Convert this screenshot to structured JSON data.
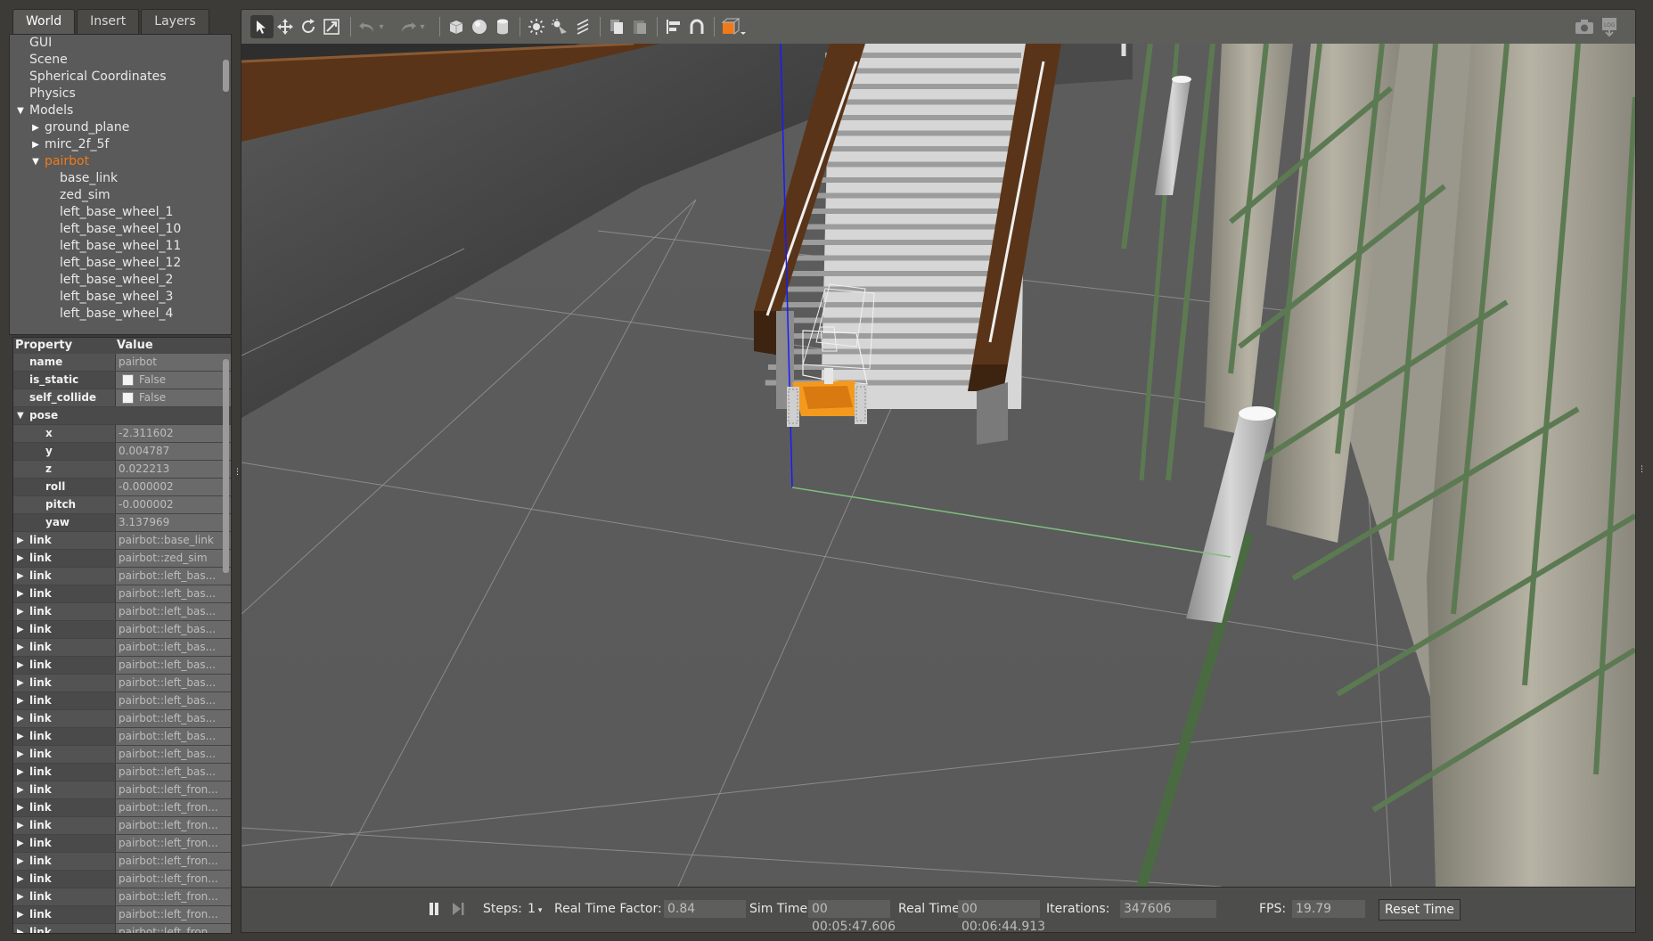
{
  "tabs": [
    "World",
    "Insert",
    "Layers"
  ],
  "tree": [
    {
      "label": "GUI",
      "indent": 0,
      "arrow": ""
    },
    {
      "label": "Scene",
      "indent": 0,
      "arrow": ""
    },
    {
      "label": "Spherical Coordinates",
      "indent": 0,
      "arrow": ""
    },
    {
      "label": "Physics",
      "indent": 0,
      "arrow": ""
    },
    {
      "label": "Models",
      "indent": 0,
      "arrow": "down"
    },
    {
      "label": "ground_plane",
      "indent": 1,
      "arrow": "right"
    },
    {
      "label": "mirc_2f_5f",
      "indent": 1,
      "arrow": "right"
    },
    {
      "label": "pairbot",
      "indent": 1,
      "arrow": "down",
      "selected": true
    },
    {
      "label": "base_link",
      "indent": 2,
      "arrow": ""
    },
    {
      "label": "zed_sim",
      "indent": 2,
      "arrow": ""
    },
    {
      "label": "left_base_wheel_1",
      "indent": 2,
      "arrow": ""
    },
    {
      "label": "left_base_wheel_10",
      "indent": 2,
      "arrow": ""
    },
    {
      "label": "left_base_wheel_11",
      "indent": 2,
      "arrow": ""
    },
    {
      "label": "left_base_wheel_12",
      "indent": 2,
      "arrow": ""
    },
    {
      "label": "left_base_wheel_2",
      "indent": 2,
      "arrow": ""
    },
    {
      "label": "left_base_wheel_3",
      "indent": 2,
      "arrow": ""
    },
    {
      "label": "left_base_wheel_4",
      "indent": 2,
      "arrow": ""
    }
  ],
  "properties": {
    "header_property": "Property",
    "header_value": "Value",
    "rows": [
      {
        "key": "name",
        "value": "pairbot",
        "indent": 1,
        "arrow": ""
      },
      {
        "key": "is_static",
        "value": "False",
        "indent": 1,
        "arrow": "",
        "checkbox": true
      },
      {
        "key": "self_collide",
        "value": "False",
        "indent": 1,
        "arrow": "",
        "checkbox": true
      },
      {
        "key": "pose",
        "value": "",
        "indent": 1,
        "arrow": "down",
        "section": true
      },
      {
        "key": "x",
        "value": "-2.311602",
        "indent": 3,
        "arrow": ""
      },
      {
        "key": "y",
        "value": "0.004787",
        "indent": 3,
        "arrow": ""
      },
      {
        "key": "z",
        "value": "0.022213",
        "indent": 3,
        "arrow": ""
      },
      {
        "key": "roll",
        "value": "-0.000002",
        "indent": 3,
        "arrow": ""
      },
      {
        "key": "pitch",
        "value": "-0.000002",
        "indent": 3,
        "arrow": ""
      },
      {
        "key": "yaw",
        "value": "3.137969",
        "indent": 3,
        "arrow": ""
      },
      {
        "key": "link",
        "value": "pairbot::base_link",
        "indent": 1,
        "arrow": "right"
      },
      {
        "key": "link",
        "value": "pairbot::zed_sim",
        "indent": 1,
        "arrow": "right"
      },
      {
        "key": "link",
        "value": "pairbot::left_bas...",
        "indent": 1,
        "arrow": "right"
      },
      {
        "key": "link",
        "value": "pairbot::left_bas...",
        "indent": 1,
        "arrow": "right"
      },
      {
        "key": "link",
        "value": "pairbot::left_bas...",
        "indent": 1,
        "arrow": "right"
      },
      {
        "key": "link",
        "value": "pairbot::left_bas...",
        "indent": 1,
        "arrow": "right"
      },
      {
        "key": "link",
        "value": "pairbot::left_bas...",
        "indent": 1,
        "arrow": "right"
      },
      {
        "key": "link",
        "value": "pairbot::left_bas...",
        "indent": 1,
        "arrow": "right"
      },
      {
        "key": "link",
        "value": "pairbot::left_bas...",
        "indent": 1,
        "arrow": "right"
      },
      {
        "key": "link",
        "value": "pairbot::left_bas...",
        "indent": 1,
        "arrow": "right"
      },
      {
        "key": "link",
        "value": "pairbot::left_bas...",
        "indent": 1,
        "arrow": "right"
      },
      {
        "key": "link",
        "value": "pairbot::left_bas...",
        "indent": 1,
        "arrow": "right"
      },
      {
        "key": "link",
        "value": "pairbot::left_bas...",
        "indent": 1,
        "arrow": "right"
      },
      {
        "key": "link",
        "value": "pairbot::left_bas...",
        "indent": 1,
        "arrow": "right"
      },
      {
        "key": "link",
        "value": "pairbot::left_fron...",
        "indent": 1,
        "arrow": "right"
      },
      {
        "key": "link",
        "value": "pairbot::left_fron...",
        "indent": 1,
        "arrow": "right"
      },
      {
        "key": "link",
        "value": "pairbot::left_fron...",
        "indent": 1,
        "arrow": "right"
      },
      {
        "key": "link",
        "value": "pairbot::left_fron...",
        "indent": 1,
        "arrow": "right"
      },
      {
        "key": "link",
        "value": "pairbot::left_fron...",
        "indent": 1,
        "arrow": "right"
      },
      {
        "key": "link",
        "value": "pairbot::left_fron...",
        "indent": 1,
        "arrow": "right"
      },
      {
        "key": "link",
        "value": "pairbot::left_fron...",
        "indent": 1,
        "arrow": "right"
      },
      {
        "key": "link",
        "value": "pairbot::left_fron...",
        "indent": 1,
        "arrow": "right"
      },
      {
        "key": "link",
        "value": "pairbot::left_fron...",
        "indent": 1,
        "arrow": "right"
      },
      {
        "key": "link",
        "value": "pairbot::left_fron...",
        "indent": 1,
        "arrow": "right"
      }
    ]
  },
  "toolbar": {
    "icons": [
      "select-icon",
      "translate-icon",
      "rotate-icon",
      "scale-icon",
      "undo-icon",
      "undo-dropdown-icon",
      "redo-icon",
      "redo-dropdown-icon",
      "box-icon",
      "sphere-icon",
      "cylinder-icon",
      "point-light-icon",
      "spot-light-icon",
      "directional-light-icon",
      "copy-icon",
      "paste-icon",
      "align-icon",
      "snap-icon",
      "change-view-icon",
      "screenshot-icon",
      "log-icon"
    ]
  },
  "bottombar": {
    "steps_label": "Steps:",
    "steps_value": "1",
    "rtf_label": "Real Time Factor:",
    "rtf_value": "0.84",
    "sim_time_label": "Sim Time:",
    "sim_time_value": "00 00:05:47.606",
    "real_time_label": "Real Time:",
    "real_time_value": "00 00:06:44.913",
    "iterations_label": "Iterations:",
    "iterations_value": "347606",
    "fps_label": "FPS:",
    "fps_value": "19.79",
    "reset_label": "Reset Time"
  },
  "colors": {
    "selected": "#f07a1a",
    "robot": "#f39a1e",
    "z_axis": "#1a1aff",
    "x_axis": "#7fbf7f",
    "railing": "#5a3418",
    "pillar_green": "#5c7a52"
  }
}
